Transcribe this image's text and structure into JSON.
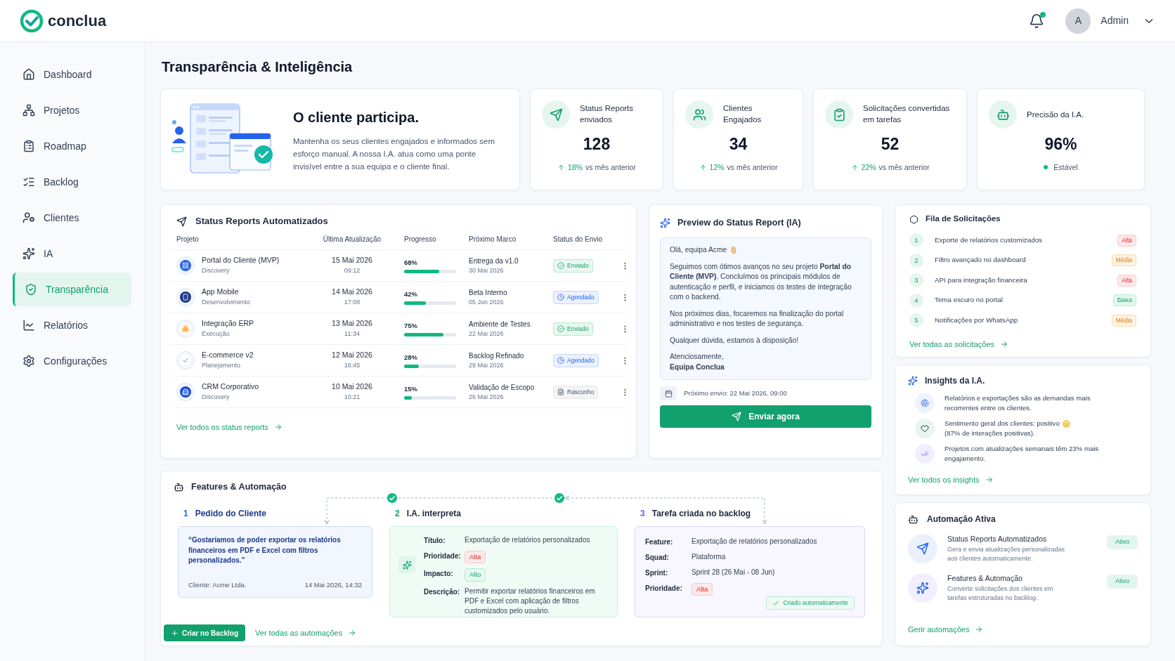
{
  "brand": {
    "name": "conclua"
  },
  "header": {
    "has_notifications": true,
    "user_initial": "A",
    "user_name": "Admin"
  },
  "sidebar": {
    "items": [
      {
        "label": "Dashboard",
        "selected": false
      },
      {
        "label": "Projetos",
        "selected": false
      },
      {
        "label": "Roadmap",
        "selected": false
      },
      {
        "label": "Backlog",
        "selected": false
      },
      {
        "label": "Clientes",
        "selected": false
      },
      {
        "label": "IA",
        "selected": false
      },
      {
        "label": "Transparência",
        "selected": true
      },
      {
        "label": "Relatórios",
        "selected": false
      },
      {
        "label": "Configurações",
        "selected": false
      }
    ]
  },
  "page_title": "Transparência & Inteligência",
  "hero": {
    "title": "O cliente participa.",
    "text": "Mantenha os seus clientes engajados e informados sem esforço manual. A nossa I.A. atua como uma ponte invisível entre a sua equipa e o cliente final."
  },
  "stats": [
    {
      "label": "Status Reports enviados",
      "value": "128",
      "kind": "trend",
      "change": "18%",
      "note": "vs mês anterior"
    },
    {
      "label": "Clientes Engajados",
      "value": "34",
      "kind": "trend",
      "change": "12%",
      "note": "vs mês anterior"
    },
    {
      "label": "Solicitações convertidas em tarefas",
      "value": "52",
      "kind": "trend",
      "change": "22%",
      "note": "vs mês anterior"
    },
    {
      "label": "Precisão da I.A.",
      "value": "96%",
      "kind": "status",
      "note": "Estável"
    }
  ],
  "status_reports": {
    "title": "Status Reports Automatizados",
    "columns": [
      "Projeto",
      "Última Atualização",
      "Progresso",
      "Próximo Marco",
      "Status do Envio"
    ],
    "rows": [
      {
        "project": "Portal do Cliente (MVP)",
        "phase": "Discovery",
        "date": "15 Mai 2026",
        "time": "09:12",
        "percent": "68%",
        "level": 0.68,
        "milestone": "Entrega da v1.0",
        "milestone_date": "30 Mai 2026",
        "status": {
          "label": "Enviado",
          "kind": "sent"
        }
      },
      {
        "project": "App Mobile",
        "phase": "Desenvolvimento",
        "date": "14 Mai 2026",
        "time": "17:08",
        "percent": "42%",
        "level": 0.42,
        "milestone": "Beta Interno",
        "milestone_date": "05 Jun 2026",
        "status": {
          "label": "Agendado",
          "kind": "scheduled"
        }
      },
      {
        "project": "Integração ERP",
        "phase": "Execução",
        "date": "13 Mai 2026",
        "time": "11:34",
        "percent": "75%",
        "level": 0.75,
        "milestone": "Ambiente de Testes",
        "milestone_date": "22 Mai 2026",
        "status": {
          "label": "Enviado",
          "kind": "sent"
        }
      },
      {
        "project": "E-commerce v2",
        "phase": "Planejamento",
        "date": "12 Mai 2026",
        "time": "16:45",
        "percent": "28%",
        "level": 0.28,
        "milestone": "Backlog Refinado",
        "milestone_date": "29 Mai 2026",
        "status": {
          "label": "Agendado",
          "kind": "scheduled"
        }
      },
      {
        "project": "CRM Corporativo",
        "phase": "Discovery",
        "date": "10 Mai 2026",
        "time": "10:21",
        "percent": "15%",
        "level": 0.15,
        "milestone": "Validação de Escopo",
        "milestone_date": "26 Mai 2026",
        "status": {
          "label": "Rascunho",
          "kind": "draft"
        }
      }
    ],
    "link": "Ver todos os status reports"
  },
  "preview": {
    "title": "Preview do Status Report (IA)",
    "greeting": "Olá, equipa Acme",
    "wave": true,
    "paragraphs": [
      "Seguimos com ótimos avanços no seu projeto **Portal do Cliente (MVP)**. Concluímos os principais módulos de autenticação e perfil, e iniciamos os testes de integração com o backend.",
      "Nos próximos dias, focaremos na finalização do portal administrativo e nos testes de segurança.",
      "Qualquer dúvida, estamos à disposição!"
    ],
    "closing": "Atenciosamente,",
    "signature": "Equipa Conclua",
    "next_send": "Próximo envio: 22 Mai 2026, 09:00",
    "button": "Enviar agora"
  },
  "requests": {
    "title": "Fila de Solicitações",
    "items": [
      {
        "number": "1",
        "text": "Exporte de relatórios customizados",
        "priority": "Alta",
        "kind": "high"
      },
      {
        "number": "2",
        "text": "Filtro avançado no dashboard",
        "priority": "Média",
        "kind": "medium"
      },
      {
        "number": "3",
        "text": "API para integração financeira",
        "priority": "Alta",
        "kind": "high"
      },
      {
        "number": "4",
        "text": "Tema escuro no portal",
        "priority": "Baixa",
        "kind": "low"
      },
      {
        "number": "5",
        "text": "Notificações por WhatsApp",
        "priority": "Média",
        "kind": "medium"
      }
    ],
    "link": "Ver todas as solicitações"
  },
  "insights": {
    "title": "Insights da I.A.",
    "items": [
      {
        "text": "Relatórios e exportações são as demandas mais recorrentes entre os clientes.",
        "smiley": false
      },
      {
        "text": "Sentimento geral dos clientes: positivo",
        "smiley": true,
        "text_2": "(87% de interações positivas)."
      },
      {
        "text": "Projetos com atualizações semanais têm 23% mais engajamento.",
        "smiley": false
      }
    ],
    "link": "Ver todos os insights"
  },
  "automations": {
    "title": "Automação Ativa",
    "items": [
      {
        "name": "Status Reports Automatizados",
        "description": "Gera e envia atualizações personalizadas aos clientes automaticamente.",
        "status": "Ativo",
        "active": true
      },
      {
        "name": "Features & Automação",
        "description": "Converte solicitações dos clientes em tarefas estruturadas no backlog.",
        "status": "Ativo",
        "active": true
      }
    ],
    "link": "Gerir automações"
  },
  "features": {
    "title": "Features & Automação",
    "request": {
      "number": "1",
      "title": "Pedido do Cliente",
      "quote": "“Gostaríamos de poder exportar os relatórios financeiros em PDF e Excel com filtros personalizados.”",
      "client": "Cliente: Acme Ltda.",
      "date": "14 Mai 2026, 14:32"
    },
    "interpretation": {
      "number": "2",
      "title": "I.A. interpreta",
      "fields": [
        {
          "label": "Título:",
          "kind": "text",
          "value": "Exportação de relatórios personalizados"
        },
        {
          "label": "Prioridade:",
          "kind": "danger",
          "value": "Alta"
        },
        {
          "label": "Impacto:",
          "kind": "success",
          "value": "Alto"
        },
        {
          "label": "Descrição:",
          "kind": "text",
          "value": "Permitir exportar relatórios financeiros em PDF e Excel com aplicação de filtros customizados pelo usuário."
        }
      ]
    },
    "task": {
      "number": "3",
      "title": "Tarefa criada no backlog",
      "fields": [
        {
          "label": "Feature:",
          "kind": "text",
          "value": "Exportação de relatórios personalizados"
        },
        {
          "label": "Squad:",
          "kind": "text",
          "value": "Plataforma"
        },
        {
          "label": "Sprint:",
          "kind": "text",
          "value": "Sprint 28 (26 Mai - 08 Jun)"
        },
        {
          "label": "Prioridade:",
          "kind": "danger",
          "value": "Alta"
        }
      ],
      "badge": "Criado automaticamente"
    },
    "button": "Criar no Backlog",
    "link": "Ver todas as automações"
  }
}
